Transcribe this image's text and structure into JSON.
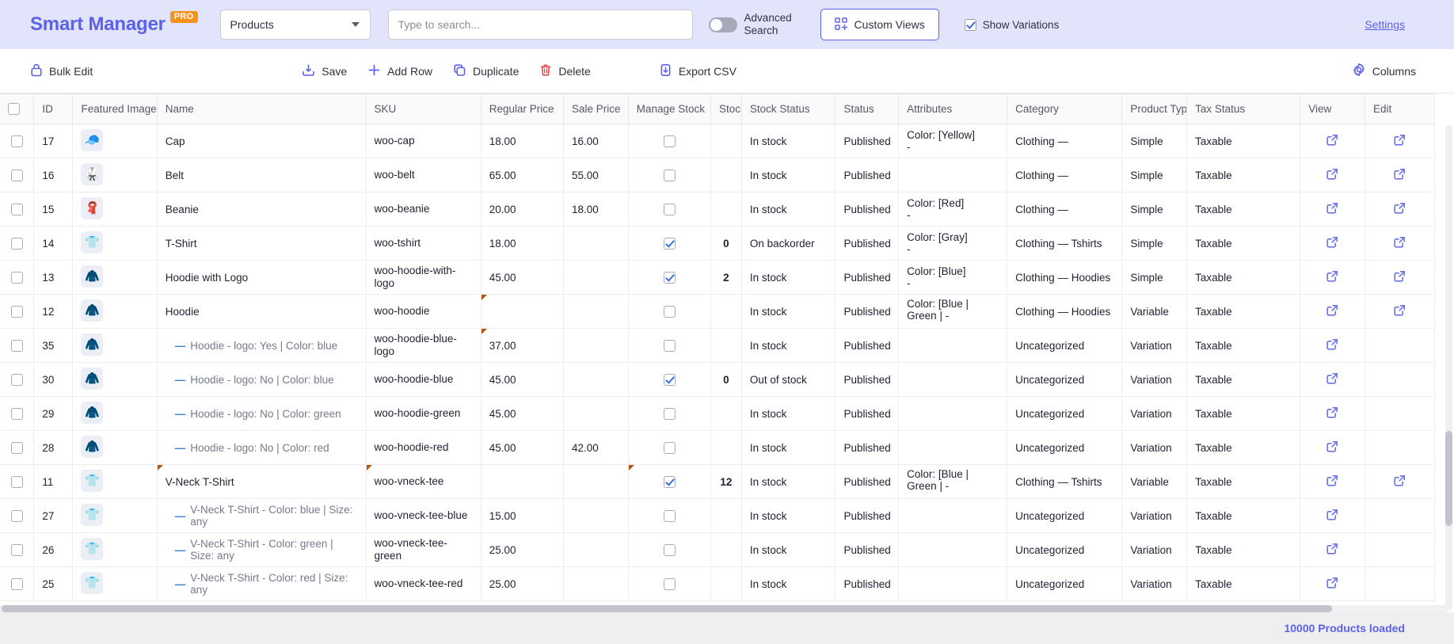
{
  "header": {
    "brand": "Smart Manager",
    "brand_badge": "PRO",
    "dashboard_select": {
      "value": "Products",
      "icon": "chevron-down-icon"
    },
    "search": {
      "value": "",
      "placeholder": "Type to search..."
    },
    "advanced_search": {
      "label": "Advanced Search",
      "enabled": false
    },
    "custom_views": {
      "label": "Custom Views",
      "icon": "grid-plus-icon"
    },
    "show_variations": {
      "label": "Show Variations",
      "checked": true
    },
    "settings_link": "Settings"
  },
  "toolbar": {
    "bulk_edit": {
      "label": "Bulk Edit",
      "icon": "lock-icon"
    },
    "save": {
      "label": "Save",
      "icon": "save-download-icon"
    },
    "add_row": {
      "label": "Add Row",
      "icon": "plus-icon"
    },
    "duplicate": {
      "label": "Duplicate",
      "icon": "copy-icon"
    },
    "delete": {
      "label": "Delete",
      "icon": "trash-icon"
    },
    "export_csv": {
      "label": "Export CSV",
      "icon": "file-download-icon"
    },
    "columns": {
      "label": "Columns",
      "icon": "gear-icon"
    }
  },
  "table": {
    "columns": [
      "",
      "ID",
      "Featured Image",
      "Name",
      "SKU",
      "Regular Price",
      "Sale Price",
      "Manage Stock",
      "Stock",
      "Stock Status",
      "Status",
      "Attributes",
      "Category",
      "Product Type",
      "Tax Status",
      "View",
      "Edit"
    ],
    "rows": [
      {
        "selected": false,
        "id": "17",
        "image": "cap",
        "name": "Cap",
        "variation": false,
        "sku": "woo-cap",
        "regular_price": "18.00",
        "sale_price": "16.00",
        "manage_stock": false,
        "stock": "",
        "stock_tone": "",
        "stock_status": "In stock",
        "status_tone": "green",
        "status": "Published",
        "attributes": "Color: [Yellow]",
        "category": "Clothing —",
        "product_type": "Simple",
        "tax_status": "Taxable",
        "view": true,
        "edit": true,
        "flags": []
      },
      {
        "selected": false,
        "id": "16",
        "image": "belt",
        "name": "Belt",
        "variation": false,
        "sku": "woo-belt",
        "regular_price": "65.00",
        "sale_price": "55.00",
        "manage_stock": false,
        "stock": "",
        "stock_tone": "",
        "stock_status": "In stock",
        "status_tone": "green",
        "status": "Published",
        "attributes": "",
        "category": "Clothing —",
        "product_type": "Simple",
        "tax_status": "Taxable",
        "view": true,
        "edit": true,
        "flags": []
      },
      {
        "selected": false,
        "id": "15",
        "image": "beanie",
        "name": "Beanie",
        "variation": false,
        "sku": "woo-beanie",
        "regular_price": "20.00",
        "sale_price": "18.00",
        "manage_stock": false,
        "stock": "",
        "stock_tone": "",
        "stock_status": "In stock",
        "status_tone": "green",
        "status": "Published",
        "attributes": "Color: [Red]",
        "category": "Clothing —",
        "product_type": "Simple",
        "tax_status": "Taxable",
        "view": true,
        "edit": true,
        "flags": []
      },
      {
        "selected": false,
        "id": "14",
        "image": "tshirt",
        "name": "T-Shirt",
        "variation": false,
        "sku": "woo-tshirt",
        "regular_price": "18.00",
        "sale_price": "",
        "manage_stock": true,
        "stock": "0",
        "stock_tone": "red",
        "stock_status": "On backorder",
        "status_tone": "blue",
        "status": "Published",
        "attributes": "Color: [Gray]",
        "category": "Clothing — Tshirts",
        "product_type": "Simple",
        "tax_status": "Taxable",
        "view": true,
        "edit": true,
        "flags": []
      },
      {
        "selected": false,
        "id": "13",
        "image": "hoodie-logo",
        "name": "Hoodie with Logo",
        "variation": false,
        "sku": "woo-hoodie-with-logo",
        "regular_price": "45.00",
        "sale_price": "",
        "manage_stock": true,
        "stock": "2",
        "stock_tone": "orange",
        "stock_status": "In stock",
        "status_tone": "green",
        "status": "Published",
        "attributes": "Color: [Blue]",
        "category": "Clothing — Hoodies",
        "product_type": "Simple",
        "tax_status": "Taxable",
        "view": true,
        "edit": true,
        "flags": []
      },
      {
        "selected": false,
        "id": "12",
        "image": "hoodie-red",
        "name": "Hoodie",
        "variation": false,
        "sku": "woo-hoodie",
        "regular_price": "",
        "sale_price": "",
        "manage_stock": false,
        "stock": "",
        "stock_tone": "",
        "stock_status": "In stock",
        "status_tone": "green",
        "status": "Published",
        "attributes": "Color: [Blue | Green | -",
        "category": "Clothing — Hoodies",
        "product_type": "Variable",
        "tax_status": "Taxable",
        "view": true,
        "edit": true,
        "flags": [
          "regular_price"
        ]
      },
      {
        "selected": false,
        "id": "35",
        "image": "hoodie-blue",
        "name": "Hoodie - logo: Yes | Color: blue",
        "variation": true,
        "sku": "woo-hoodie-blue-logo",
        "regular_price": "37.00",
        "sale_price": "",
        "manage_stock": false,
        "stock": "",
        "stock_tone": "",
        "stock_status": "In stock",
        "status_tone": "green",
        "status": "Published",
        "attributes": "",
        "category": "Uncategorized",
        "product_type": "Variation",
        "tax_status": "Taxable",
        "view": true,
        "edit": false,
        "flags": [
          "regular_price"
        ]
      },
      {
        "selected": false,
        "id": "30",
        "image": "hoodie-blue",
        "name": "Hoodie - logo: No | Color: blue",
        "variation": true,
        "sku": "woo-hoodie-blue",
        "regular_price": "45.00",
        "sale_price": "",
        "manage_stock": true,
        "stock": "0",
        "stock_tone": "red",
        "stock_status": "Out of stock",
        "status_tone": "red",
        "status": "Published",
        "attributes": "",
        "category": "Uncategorized",
        "product_type": "Variation",
        "tax_status": "Taxable",
        "view": true,
        "edit": false,
        "flags": []
      },
      {
        "selected": false,
        "id": "29",
        "image": "hoodie-green",
        "name": "Hoodie - logo: No | Color: green",
        "variation": true,
        "sku": "woo-hoodie-green",
        "regular_price": "45.00",
        "sale_price": "",
        "manage_stock": false,
        "stock": "",
        "stock_tone": "",
        "stock_status": "In stock",
        "status_tone": "green",
        "status": "Published",
        "attributes": "",
        "category": "Uncategorized",
        "product_type": "Variation",
        "tax_status": "Taxable",
        "view": true,
        "edit": false,
        "flags": []
      },
      {
        "selected": false,
        "id": "28",
        "image": "hoodie-red",
        "name": "Hoodie - logo: No | Color: red",
        "variation": true,
        "sku": "woo-hoodie-red",
        "regular_price": "45.00",
        "sale_price": "42.00",
        "manage_stock": false,
        "stock": "",
        "stock_tone": "",
        "stock_status": "In stock",
        "status_tone": "green",
        "status": "Published",
        "attributes": "",
        "category": "Uncategorized",
        "product_type": "Variation",
        "tax_status": "Taxable",
        "view": true,
        "edit": false,
        "flags": []
      },
      {
        "selected": false,
        "id": "11",
        "image": "vneck-red",
        "name": "V-Neck T-Shirt",
        "variation": false,
        "sku": "woo-vneck-tee",
        "regular_price": "",
        "sale_price": "",
        "manage_stock": true,
        "stock": "12",
        "stock_tone": "green",
        "stock_status": "In stock",
        "status_tone": "green",
        "status": "Published",
        "attributes": "Color: [Blue | Green | -",
        "category": "Clothing — Tshirts",
        "product_type": "Variable",
        "tax_status": "Taxable",
        "view": true,
        "edit": true,
        "flags": [
          "name",
          "sku",
          "manage_stock"
        ]
      },
      {
        "selected": false,
        "id": "27",
        "image": "vneck-blue",
        "name": "V-Neck T-Shirt - Color: blue | Size: any",
        "variation": true,
        "sku": "woo-vneck-tee-blue",
        "regular_price": "15.00",
        "sale_price": "",
        "manage_stock": false,
        "stock": "",
        "stock_tone": "",
        "stock_status": "In stock",
        "status_tone": "green",
        "status": "Published",
        "attributes": "",
        "category": "Uncategorized",
        "product_type": "Variation",
        "tax_status": "Taxable",
        "view": true,
        "edit": false,
        "flags": []
      },
      {
        "selected": false,
        "id": "26",
        "image": "vneck-green",
        "name": "V-Neck T-Shirt - Color: green | Size: any",
        "variation": true,
        "sku": "woo-vneck-tee-green",
        "regular_price": "25.00",
        "sale_price": "",
        "manage_stock": false,
        "stock": "",
        "stock_tone": "",
        "stock_status": "In stock",
        "status_tone": "green",
        "status": "Published",
        "attributes": "",
        "category": "Uncategorized",
        "product_type": "Variation",
        "tax_status": "Taxable",
        "view": true,
        "edit": false,
        "flags": []
      },
      {
        "selected": false,
        "id": "25",
        "image": "vneck-red",
        "name": "V-Neck T-Shirt - Color: red | Size: any",
        "variation": true,
        "sku": "woo-vneck-tee-red",
        "regular_price": "25.00",
        "sale_price": "",
        "manage_stock": false,
        "stock": "",
        "stock_tone": "",
        "stock_status": "In stock",
        "status_tone": "green",
        "status": "Published",
        "attributes": "",
        "category": "Uncategorized",
        "product_type": "Variation",
        "tax_status": "Taxable",
        "view": true,
        "edit": false,
        "flags": []
      }
    ],
    "select_all_checked": false
  },
  "footer": {
    "status_text": "10000 Products loaded"
  },
  "colors": {
    "brand": "#5c62e8",
    "header_bg": "#e1e4fb",
    "badge": "#f6921e",
    "in_stock": "#2e9b4e",
    "out_of_stock": "#f1706f",
    "on_backorder": "#6b73e8",
    "stock_low": "#e08b1e",
    "stock_zero": "#e5484d",
    "delete": "#e5484d"
  }
}
